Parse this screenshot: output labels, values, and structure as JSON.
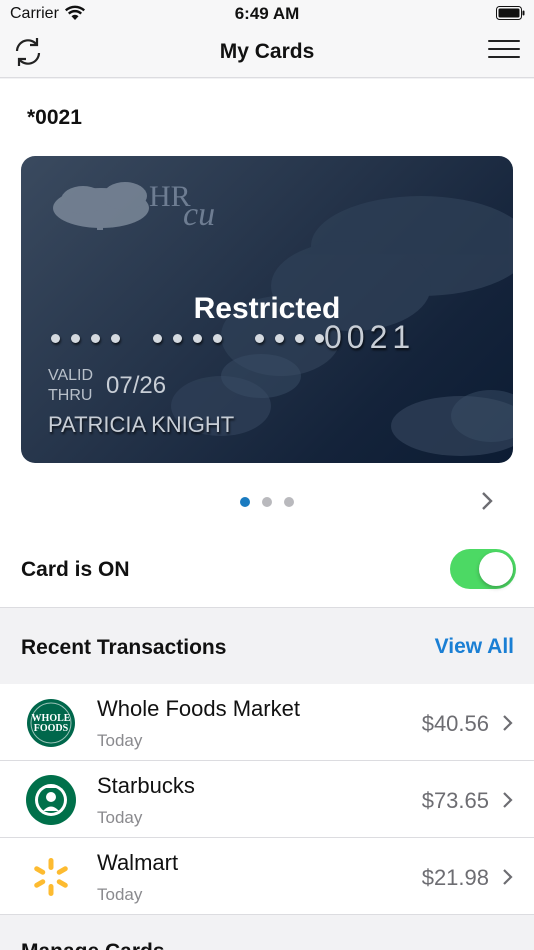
{
  "status_bar": {
    "carrier": "Carrier",
    "time": "6:49 AM"
  },
  "nav": {
    "title": "My Cards",
    "refresh_icon": "refresh-icon",
    "menu_icon": "hamburger-menu-icon"
  },
  "card": {
    "last4_title": "*0021",
    "issuer_logo_line1": "HR",
    "issuer_logo_line2": "CU",
    "status": "Restricted",
    "number_last4": "0021",
    "valid_label_line1": "VALID",
    "valid_label_line2": "THRU",
    "expiry": "07/26",
    "holder": "PATRICIA KNIGHT",
    "colors": {
      "card_dark": "#0c1c33",
      "card_light": "#3a4a5f"
    }
  },
  "pager": {
    "count": 3,
    "active_index": 0
  },
  "card_toggle": {
    "label": "Card is ON",
    "on": true,
    "color": "#4cd964"
  },
  "transactions": {
    "title": "Recent Transactions",
    "view_all": "View All",
    "items": [
      {
        "merchant": "Whole Foods Market",
        "date": "Today",
        "amount": "$40.56",
        "logo": "whole-foods-logo"
      },
      {
        "merchant": "Starbucks",
        "date": "Today",
        "amount": "$73.65",
        "logo": "starbucks-logo"
      },
      {
        "merchant": "Walmart",
        "date": "Today",
        "amount": "$21.98",
        "logo": "walmart-logo"
      }
    ]
  },
  "next_section": {
    "title": "Manage Cards"
  },
  "colors": {
    "accent": "#1a7fd4",
    "active_dot": "#1a7bc0"
  }
}
